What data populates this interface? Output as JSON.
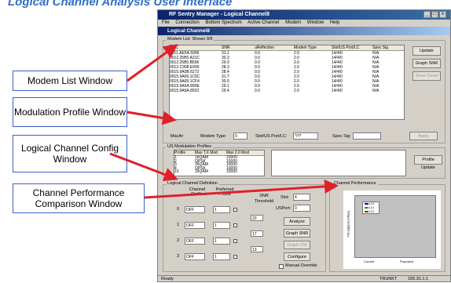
{
  "slide_title": "Logical Channel Analysis User Interface",
  "window": {
    "title": "RF Sentry Manager - Logical Channel8",
    "controls": [
      "_",
      "□",
      "x"
    ],
    "menu": [
      "File",
      "Connection",
      "Bottom Spectrum",
      "Active Channel",
      "Modem",
      "Window",
      "Help"
    ],
    "child_title": "Logical Channel8"
  },
  "modem_list": {
    "group_label": "Modem List: Shown 9/9",
    "headers": [
      "MAC",
      "SNR",
      "uReflection",
      "Modem Type",
      "Slot/US Port/LC",
      "Spec Sig"
    ],
    "rows": [
      [
        "0011.AE5A.5996",
        "31.1",
        "0.0",
        "2.0",
        "14/4/0",
        "N/A"
      ],
      [
        "0012.25B5.A31C",
        "30.3",
        "0.0",
        "2.0",
        "14/4/0",
        "N/A"
      ],
      [
        "0012.25B5.B596",
        "29.9",
        "0.0",
        "2.0",
        "14/4/0",
        "N/A"
      ],
      [
        "0012.C908.E099",
        "28.3",
        "0.0",
        "2.0",
        "14/4/0",
        "N/A"
      ],
      [
        "0015.9A0B.6272",
        "28.4",
        "0.0",
        "2.0",
        "14/4/0",
        "N/A"
      ],
      [
        "0015.9A69.1C5C",
        "31.7",
        "0.0",
        "2.0",
        "14/4/0",
        "N/A"
      ],
      [
        "0015.9A69.1CF4",
        "30.5",
        "0.0",
        "2.0",
        "14/4/0",
        "N/A"
      ],
      [
        "0015.9A6A.890E",
        "29.1",
        "0.0",
        "2.0",
        "14/4/0",
        "N/A"
      ],
      [
        "0015.9A6A.8922",
        "29.4",
        "0.0",
        "2.0",
        "14/4/0",
        "N/A"
      ]
    ],
    "buttons": {
      "update": "Update",
      "graph_snr": "Graph SNR",
      "show_detail": "Show Detail"
    },
    "filter": {
      "mac_label": "MacAr:",
      "modem_type_label": "Modem Type:",
      "modem_type_value": "0",
      "slot_label": "Slot/US Port/LC:",
      "slot_value": "*/*/*",
      "spec_sig_label": "Spec Sig:",
      "apply": "Apply"
    }
  },
  "modulation": {
    "group_label": "US Modulation Profiles",
    "headers": [
      "Profile",
      "Max T.X Mod",
      "Max 2.0 Mod"
    ],
    "rows": [
      [
        "1",
        "16QAM",
        "10000"
      ],
      [
        "2",
        "QPSK",
        "10000"
      ],
      [
        "3",
        "16QAM",
        "10000"
      ],
      [
        "4",
        "QPSK",
        "10000"
      ],
      [
        "10",
        "16QAM",
        "10000"
      ],
      [
        "",
        "",
        ""
      ]
    ],
    "button": "Profile Update"
  },
  "lc_def": {
    "group_label": "Logical Channel Definition",
    "col_headers": [
      "Channel Profile",
      "Preferred Profile",
      "SNR Threshold"
    ],
    "rows": [
      {
        "id": "0",
        "state": "OFF",
        "profile": "1",
        "thresh": ""
      },
      {
        "id": "1",
        "state": "OFF",
        "profile": "1",
        "thresh": "20"
      },
      {
        "id": "2",
        "state": "OFF",
        "profile": "1",
        "thresh": "17"
      },
      {
        "id": "3",
        "state": "OFF",
        "profile": "1",
        "thresh": "13"
      }
    ],
    "slot_label": "Slot:",
    "slot_value": "4",
    "usport_label": "USPort:",
    "usport_value": "0",
    "buttons": {
      "analyze": "Analyze",
      "graph_snr": "Graph SNR",
      "graph_cw": "Graph CW",
      "configure": "Configure"
    },
    "manual_override": "Manual Override"
  },
  "performance": {
    "group_label": "Channel Performance",
    "ylabel": "Throughput (Mbps)",
    "xlabels": [
      "Current",
      "Proposed"
    ],
    "legend": [
      "LC0",
      "LC1",
      "LC2"
    ]
  },
  "status": {
    "left": "Ready",
    "middle": "TRUNKT",
    "right": "155.31.1.1"
  },
  "callouts": {
    "modem_list": "Modem List Window",
    "modulation": "Modulation Profile Window",
    "lc_config": "Logical Channel Config Window",
    "performance": "Channel Performance Comparison Window"
  },
  "colors": {
    "callout_border": "#3a5fcd",
    "arrow": "#e0202a",
    "slide_title": "#2f6fc6",
    "window_face": "#d4d0c8"
  }
}
